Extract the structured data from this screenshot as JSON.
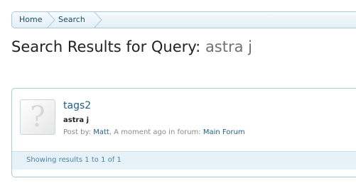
{
  "breadcrumb": {
    "home": "Home",
    "search": "Search"
  },
  "page": {
    "title_prefix": "Search Results for Query:",
    "query": "astra j"
  },
  "result": {
    "title": "tags2",
    "snippet": "astra j",
    "posted_by_label": "Post by:",
    "author": "Matt",
    "time": "A moment ago",
    "in_forum_label": "in forum:",
    "forum": "Main Forum"
  },
  "pager": {
    "text": "Showing results 1 to 1 of 1"
  },
  "colors": {
    "link": "#1f5f84",
    "border": "#a9c9da",
    "pager_bg": "#e6f1f8"
  }
}
